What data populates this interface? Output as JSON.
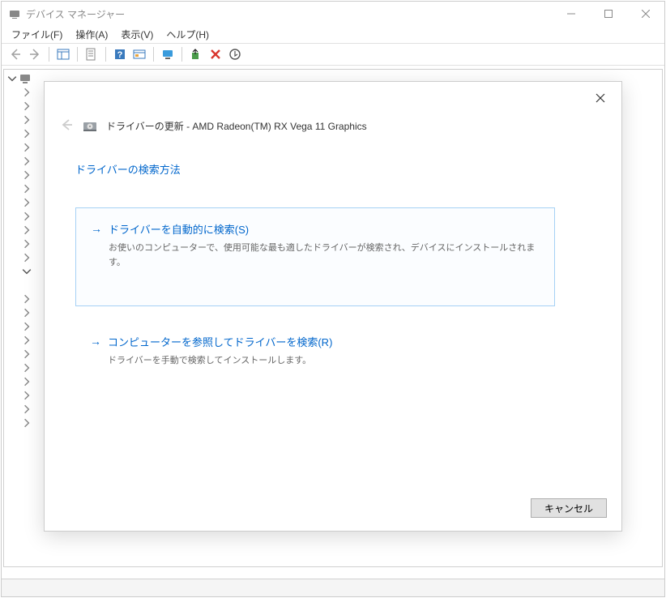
{
  "window": {
    "title": "デバイス マネージャー"
  },
  "menubar": {
    "file": "ファイル(F)",
    "action": "操作(A)",
    "view": "表示(V)",
    "help": "ヘルプ(H)"
  },
  "dialog": {
    "title": "ドライバーの更新 - AMD Radeon(TM) RX Vega 11 Graphics",
    "heading": "ドライバーの検索方法",
    "option1": {
      "title": "ドライバーを自動的に検索(S)",
      "desc": "お使いのコンピューターで、使用可能な最も適したドライバーが検索され、デバイスにインストールされます。"
    },
    "option2": {
      "title": "コンピューターを参照してドライバーを検索(R)",
      "desc": "ドライバーを手動で検索してインストールします。"
    },
    "cancel": "キャンセル"
  }
}
